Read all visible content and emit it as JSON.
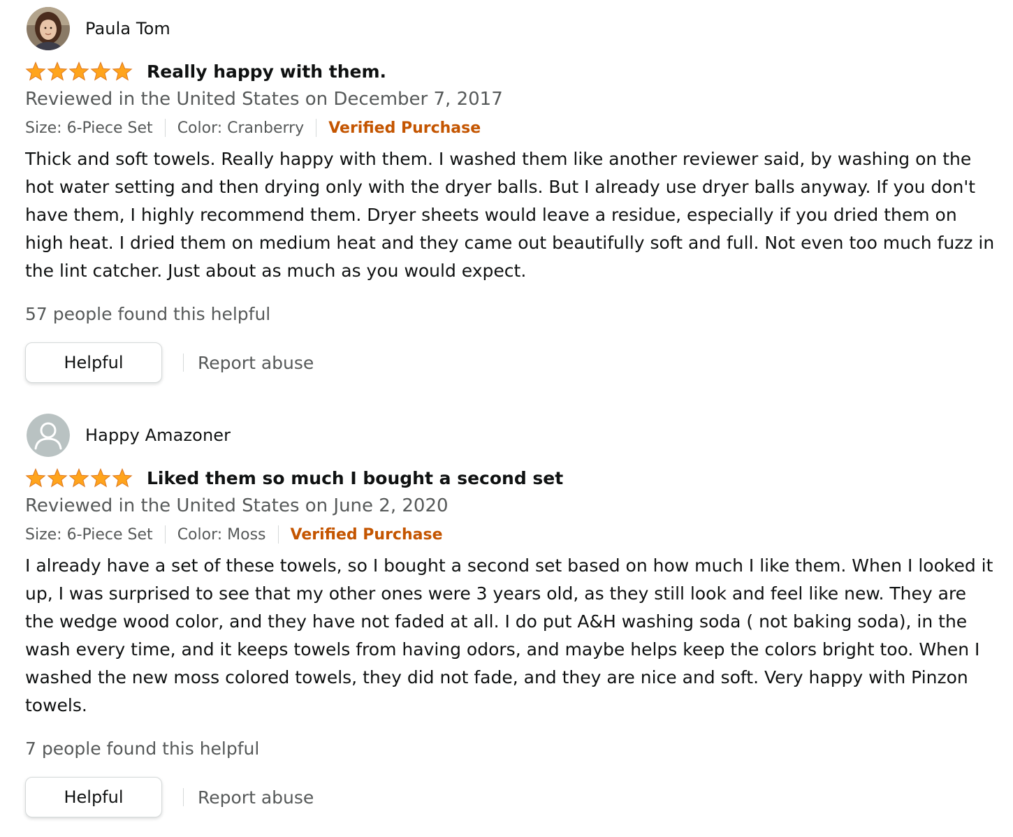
{
  "colors": {
    "text": "#0f1111",
    "secondary_text": "#565959",
    "verified": "#c45500",
    "star": "#ffa41c",
    "border": "#d5d9d9"
  },
  "reviews": [
    {
      "profile_name": "Paula Tom",
      "avatar_icon": "user-photo",
      "rating": 5,
      "title": "Really happy with them.",
      "date": "Reviewed in the United States on December 7, 2017",
      "size": "Size: 6-Piece Set",
      "color": "Color: Cranberry",
      "verified": "Verified Purchase",
      "body": "Thick and soft towels. Really happy with them. I washed them like another reviewer said, by washing on the hot water setting and then drying only with the dryer balls. But I already use dryer balls anyway. If you don't have them, I highly recommend them. Dryer sheets would leave a residue, especially if you dried them on high heat. I dried them on medium heat and they came out beautifully soft and full. Not even too much fuzz in the lint catcher. Just about as much as you would expect.",
      "helpful_count": "57 people found this helpful",
      "helpful_button": "Helpful",
      "report": "Report abuse"
    },
    {
      "profile_name": "Happy Amazoner",
      "avatar_icon": "default-user-icon",
      "rating": 5,
      "title": "Liked them so much I bought a second set",
      "date": "Reviewed in the United States on June 2, 2020",
      "size": "Size: 6-Piece Set",
      "color": "Color: Moss",
      "verified": "Verified Purchase",
      "body": "I already have a set of these towels, so I bought a second set based on how much I like them. When I looked it up, I was surprised to see that my other ones were 3 years old, as they still look and feel like new. They are the wedge wood color, and they have not faded at all. I do put A&H washing soda ( not baking soda), in the wash every time, and it keeps towels from having odors, and maybe helps keep the colors bright too. When I washed the new moss colored towels, they did not fade, and they are nice and soft. Very happy with Pinzon towels.",
      "helpful_count": "7 people found this helpful",
      "helpful_button": "Helpful",
      "report": "Report abuse"
    }
  ]
}
